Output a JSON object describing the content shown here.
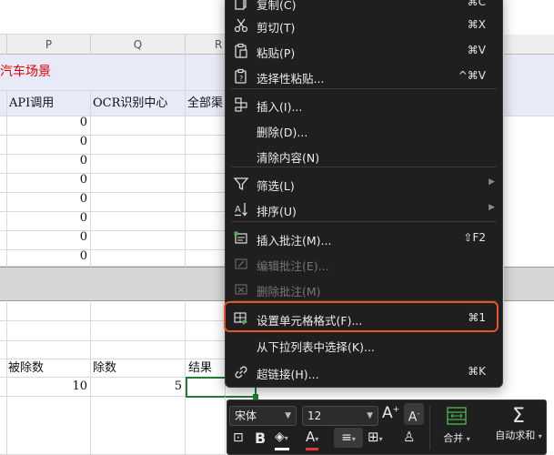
{
  "columns": [
    "P",
    "Q",
    "R"
  ],
  "sheet": {
    "banner": "汽车场景",
    "headers": [
      "API调用",
      "OCR识别中心",
      "全部渠"
    ],
    "api_values": [
      "0",
      "0",
      "0",
      "0",
      "0",
      "0",
      "0",
      "0"
    ],
    "labels": [
      "被除数",
      "除数",
      "结果"
    ],
    "dividend": "10",
    "divisor": "5"
  },
  "menu": {
    "items": [
      {
        "label": "复制(C)",
        "shortcut": "⌘C",
        "icon": "copy-icon"
      },
      {
        "label": "剪切(T)",
        "shortcut": "⌘X",
        "icon": "scissors-icon"
      },
      {
        "label": "粘贴(P)",
        "shortcut": "⌘V",
        "icon": "paste-icon"
      },
      {
        "label": "选择性粘贴...",
        "shortcut": "^⌘V",
        "icon": "paste-special-icon"
      },
      {
        "label": "插入(I)...",
        "shortcut": "",
        "icon": "insert-icon"
      },
      {
        "label": "删除(D)...",
        "shortcut": "",
        "icon": ""
      },
      {
        "label": "清除内容(N)",
        "shortcut": "",
        "icon": ""
      },
      {
        "label": "筛选(L)",
        "shortcut": "",
        "icon": "filter-icon",
        "submenu": true
      },
      {
        "label": "排序(U)",
        "shortcut": "",
        "icon": "sort-icon",
        "submenu": true
      },
      {
        "label": "插入批注(M)...",
        "shortcut": "⇧F2",
        "icon": "insert-comment-icon"
      },
      {
        "label": "编辑批注(E)...",
        "shortcut": "",
        "icon": "edit-comment-icon",
        "disabled": true
      },
      {
        "label": "删除批注(M)",
        "shortcut": "",
        "icon": "delete-comment-icon",
        "disabled": true
      },
      {
        "label": "设置单元格格式(F)...",
        "shortcut": "⌘1",
        "icon": "format-cells-icon"
      },
      {
        "label": "从下拉列表中选择(K)...",
        "shortcut": "",
        "icon": ""
      },
      {
        "label": "超链接(H)...",
        "shortcut": "⌘K",
        "icon": "hyperlink-icon"
      }
    ]
  },
  "toolbar": {
    "font_name": "宋体",
    "font_size": "12",
    "merge_label": "合并",
    "autosum_label": "自动求和"
  },
  "colors": {
    "banner_text": "#e00000",
    "banner_bg": "#e8eaf8",
    "menu_bg": "#1f1f1f",
    "highlight": "#e8552c",
    "selection": "#1e7e34"
  }
}
